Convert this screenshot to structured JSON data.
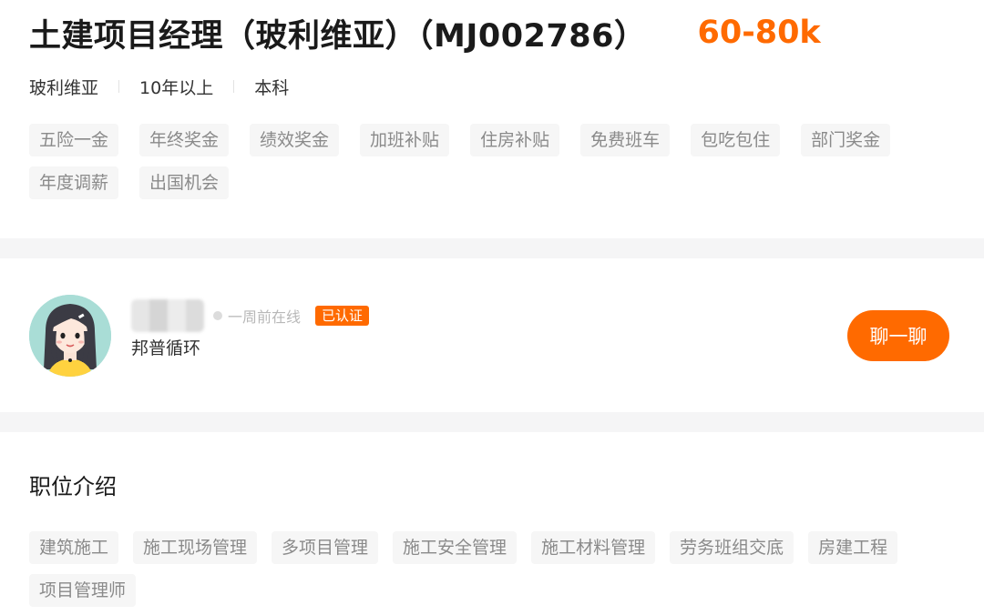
{
  "job": {
    "title": "土建项目经理（玻利维亚）（MJ002786）",
    "salary": "60-80k",
    "meta": [
      "玻利维亚",
      "10年以上",
      "本科"
    ],
    "benefits": [
      "五险一金",
      "年终奖金",
      "绩效奖金",
      "加班补贴",
      "住房补贴",
      "免费班车",
      "包吃包住",
      "部门奖金",
      "年度调薪",
      "出国机会"
    ]
  },
  "recruiter": {
    "online_status": "一周前在线",
    "verified_label": "已认证",
    "company": "邦普循环",
    "chat_label": "聊一聊"
  },
  "description": {
    "section_title": "职位介绍",
    "skills": [
      "建筑施工",
      "施工现场管理",
      "多项目管理",
      "施工安全管理",
      "施工材料管理",
      "劳务班组交底",
      "房建工程",
      "项目管理师"
    ]
  },
  "colors": {
    "accent": "#ff6a00",
    "tag_bg": "#f6f6f6",
    "tag_text": "#8a8a8a",
    "band": "#f5f5f6"
  },
  "icons": {
    "avatar": "cartoon-woman-avatar",
    "online_dot": "status-dot-icon"
  }
}
